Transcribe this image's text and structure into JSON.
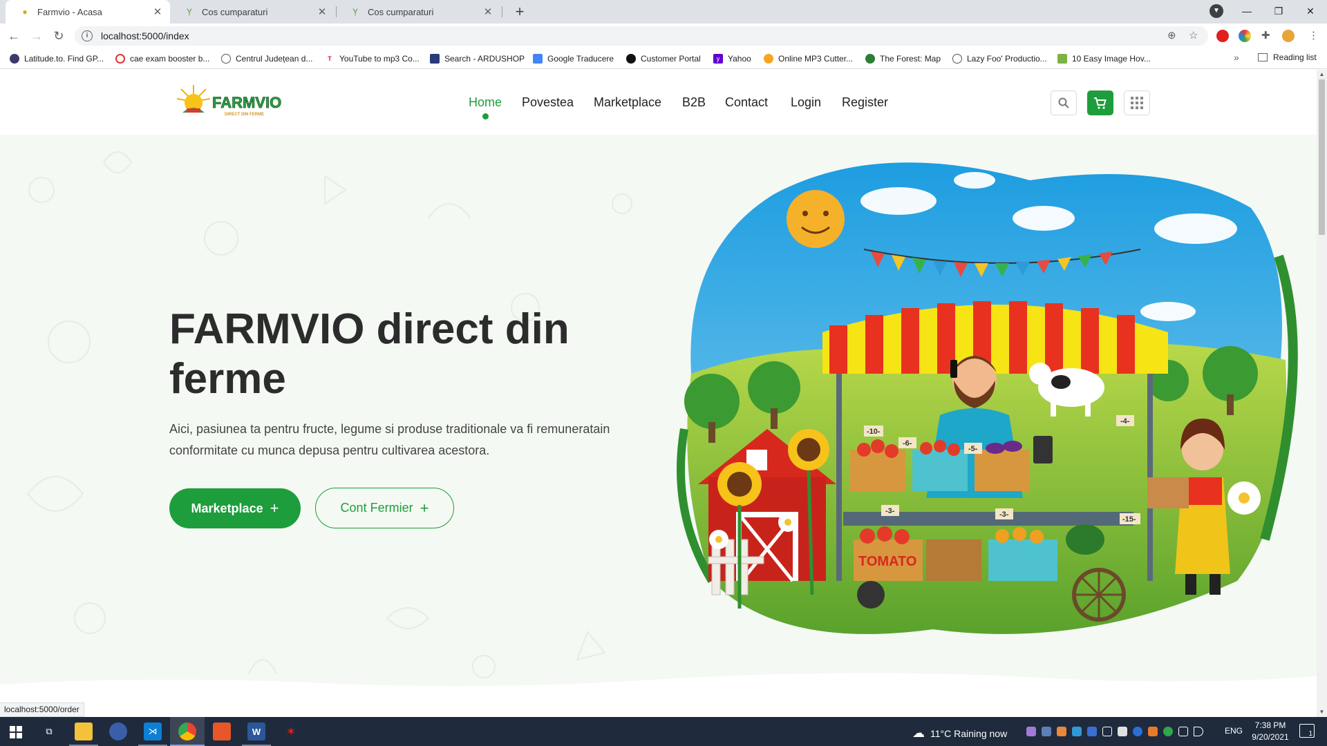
{
  "browser": {
    "tabs": [
      {
        "title": "Farmvio - Acasa",
        "active": true
      },
      {
        "title": "Cos cumparaturi",
        "active": false
      },
      {
        "title": "Cos cumparaturi",
        "active": false
      }
    ],
    "url": "localhost:5000/index",
    "bookmarks": [
      "Latitude.to. Find GP...",
      "cae exam booster b...",
      "Centrul Județean d...",
      "YouTube to mp3 Co...",
      "Search - ARDUSHOP",
      "Google Traducere",
      "Customer Portal",
      "Yahoo",
      "Online MP3 Cutter...",
      "The Forest: Map",
      "Lazy Foo' Productio...",
      "10 Easy Image Hov..."
    ],
    "reading_list": "Reading list",
    "status_url": "localhost:5000/order"
  },
  "site": {
    "logo_text": "FARMVIO",
    "logo_tagline": "DIRECT DIN FERME",
    "nav": [
      "Home",
      "Povestea",
      "Marketplace",
      "B2B",
      "Contact",
      "Login",
      "Register"
    ],
    "active_nav": "Home",
    "hero": {
      "title": "FARMVIO direct din ferme",
      "text": "Aici, pasiunea ta pentru fructe, legume si produse traditionale va fi remuneratain conformitate cu munca depusa pentru cultivarea acestora.",
      "primary_button": "Marketplace",
      "secondary_button": "Cont Fermier"
    },
    "illustration": {
      "crate_label": "TOMATO",
      "price_tags": [
        "-10-",
        "-6-",
        "-5-",
        "-4-",
        "-3-",
        "-3-",
        "-15-"
      ]
    },
    "brand_color": "#1e9d3c"
  },
  "taskbar": {
    "weather": "11°C  Raining now",
    "language": "ENG",
    "time": "7:38 PM",
    "date": "9/20/2021",
    "notification_count": "1"
  }
}
